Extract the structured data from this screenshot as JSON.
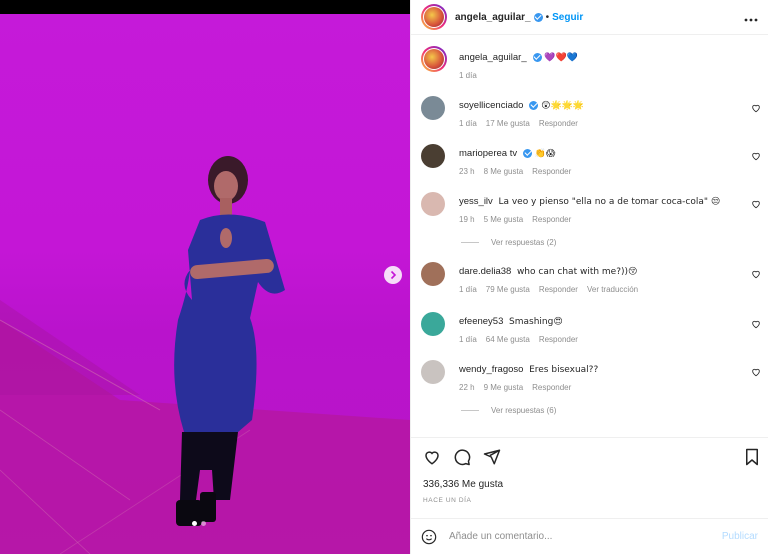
{
  "post": {
    "author": "angela_aguilar_",
    "follow_label": "Seguir",
    "bullet": "•",
    "caption_emojis": "💜❤️💙",
    "caption_time": "1 día",
    "likes_text": "336,336 Me gusta",
    "posted_when": "HACE UN DÍA",
    "carousel": {
      "slides": 2,
      "active": 1
    }
  },
  "comments": [
    {
      "user": "soyellicenciado",
      "verified": true,
      "text": "😲🌟🌟🌟",
      "time": "1 día",
      "likes": "17 Me gusta",
      "reply": "Responder",
      "extra": "",
      "avatar_color": "#7a8a96"
    },
    {
      "user": "marioperea tv",
      "verified": true,
      "text": "👏😱",
      "time": "23 h",
      "likes": "8 Me gusta",
      "reply": "Responder",
      "extra": "",
      "avatar_color": "#4a3e32"
    },
    {
      "user": "yess_ilv",
      "verified": false,
      "text": "La veo y pienso \"ella no a de tomar coca-cola\" 😒",
      "time": "19 h",
      "likes": "5 Me gusta",
      "reply": "Responder",
      "extra": "",
      "avatar_color": "#d9b8b0"
    },
    {
      "user": "dare.delia38",
      "verified": false,
      "text": "who can chat with me?))😚",
      "time": "1 día",
      "likes": "79 Me gusta",
      "reply": "Responder",
      "extra": "Ver traducción",
      "avatar_color": "#a0705a"
    },
    {
      "user": "efeeney53",
      "verified": false,
      "text": "Smashing😍",
      "time": "1 día",
      "likes": "64 Me gusta",
      "reply": "Responder",
      "extra": "",
      "avatar_color": "#3aa89a"
    },
    {
      "user": "wendy_fragoso",
      "verified": false,
      "text": "Eres bisexual??",
      "time": "22 h",
      "likes": "9 Me gusta",
      "reply": "Responder",
      "extra": "",
      "avatar_color": "#c9c3c0"
    }
  ],
  "replies": [
    {
      "after": "yess_ilv",
      "label": "Ver respuestas (2)"
    },
    {
      "after": "wendy_fragoso",
      "label": "Ver respuestas (6)"
    }
  ],
  "composer": {
    "placeholder": "Añade un comentario...",
    "publish_label": "Publicar"
  },
  "icons": [
    "heart-icon",
    "comment-icon",
    "share-icon",
    "bookmark-icon",
    "emoji-icon",
    "more-icon",
    "chevron-right-icon"
  ],
  "colors": {
    "accent": "#0095f6",
    "photo_bg": "#c51ad9",
    "text": "#262626",
    "muted": "#8e8e8e"
  }
}
